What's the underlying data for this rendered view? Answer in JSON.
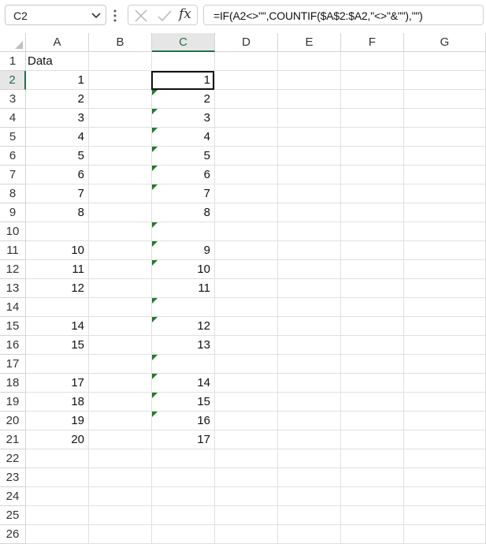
{
  "formula_bar": {
    "name_box": "C2",
    "fx_label": "fx",
    "formula": "=IF(A2<>\"\",COUNTIF($A$2:$A2,\"<>\"&\"\"),\"\")"
  },
  "columns": [
    "A",
    "B",
    "C",
    "D",
    "E",
    "F",
    "G"
  ],
  "selected_cell": "C2",
  "rows": [
    {
      "n": "1",
      "A": "Data",
      "C": ""
    },
    {
      "n": "2",
      "A": "1",
      "C": "1"
    },
    {
      "n": "3",
      "A": "2",
      "C": "2"
    },
    {
      "n": "4",
      "A": "3",
      "C": "3"
    },
    {
      "n": "5",
      "A": "4",
      "C": "4"
    },
    {
      "n": "6",
      "A": "5",
      "C": "5"
    },
    {
      "n": "7",
      "A": "6",
      "C": "6"
    },
    {
      "n": "8",
      "A": "7",
      "C": "7"
    },
    {
      "n": "9",
      "A": "8",
      "C": "8"
    },
    {
      "n": "10",
      "A": "",
      "C": ""
    },
    {
      "n": "11",
      "A": "10",
      "C": "9"
    },
    {
      "n": "12",
      "A": "11",
      "C": "10"
    },
    {
      "n": "13",
      "A": "12",
      "C": "11"
    },
    {
      "n": "14",
      "A": "",
      "C": ""
    },
    {
      "n": "15",
      "A": "14",
      "C": "12"
    },
    {
      "n": "16",
      "A": "15",
      "C": "13"
    },
    {
      "n": "17",
      "A": "",
      "C": ""
    },
    {
      "n": "18",
      "A": "17",
      "C": "14"
    },
    {
      "n": "19",
      "A": "18",
      "C": "15"
    },
    {
      "n": "20",
      "A": "19",
      "C": "16"
    },
    {
      "n": "21",
      "A": "20",
      "C": "17"
    },
    {
      "n": "22",
      "A": "",
      "C": ""
    },
    {
      "n": "23",
      "A": "",
      "C": ""
    },
    {
      "n": "24",
      "A": "",
      "C": ""
    },
    {
      "n": "25",
      "A": "",
      "C": ""
    },
    {
      "n": "26",
      "A": "",
      "C": ""
    }
  ],
  "error_indicator_rows": [
    "3",
    "4",
    "5",
    "6",
    "7",
    "8",
    "10",
    "11",
    "12",
    "14",
    "15",
    "17",
    "18",
    "19",
    "20"
  ],
  "colors": {
    "accent": "#1f7146",
    "error_triangle": "#1f7b2a",
    "gridline": "#e1e1e1"
  }
}
